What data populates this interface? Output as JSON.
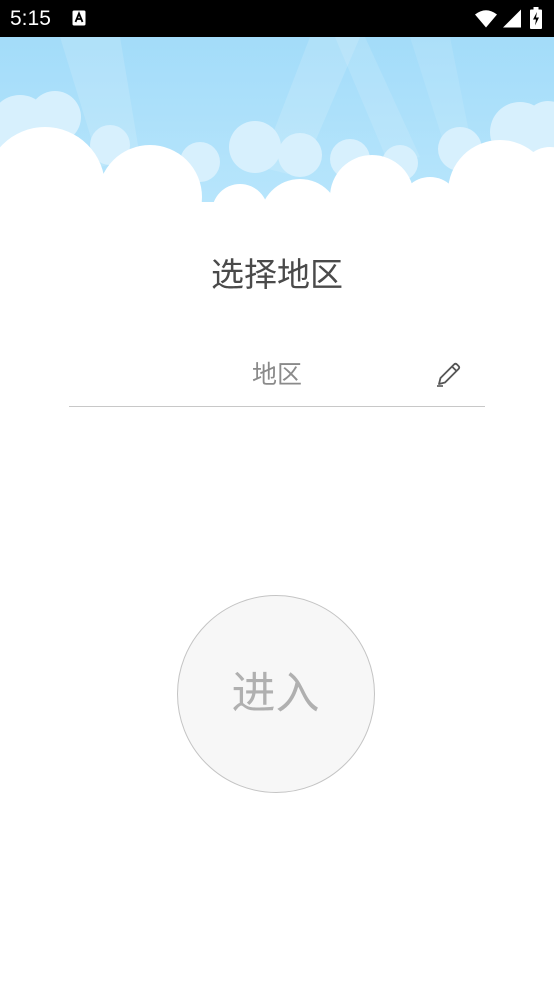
{
  "status_bar": {
    "time": "5:15",
    "icons": [
      "notification-a-icon",
      "wifi-icon",
      "signal-icon",
      "battery-charging-icon"
    ]
  },
  "page": {
    "title": "选择地区",
    "region_field": {
      "label": "地区",
      "icon": "pencil-edit-icon"
    },
    "enter_button": {
      "label": "进入"
    }
  },
  "colors": {
    "status_bar_bg": "#000000",
    "sky_top": "#a6e0fb",
    "clouds": "#ffffff",
    "title_text": "#4a4a4a",
    "field_label": "#8a8a8a",
    "field_underline": "#c8c8c8",
    "button_bg": "#f7f7f7",
    "button_border": "#c4c4c4",
    "button_text": "#b0b0b0"
  }
}
